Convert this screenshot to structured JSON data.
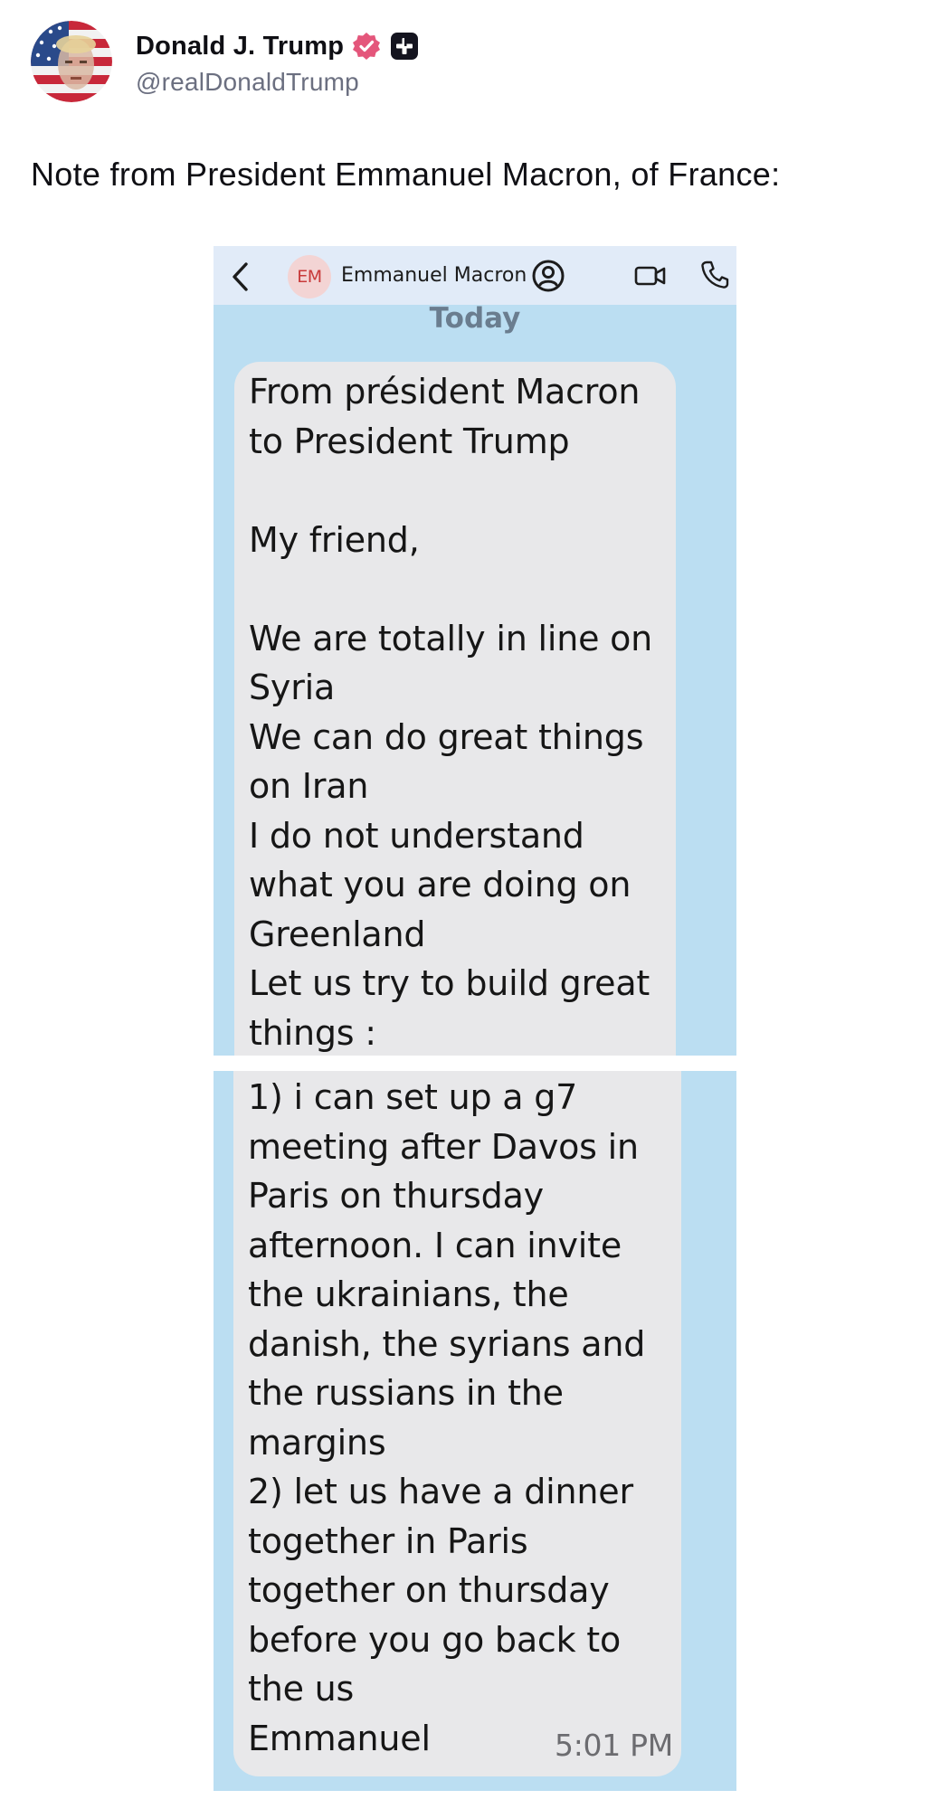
{
  "post": {
    "display_name": "Donald J. Trump",
    "handle": "@realDonaldTrump",
    "avatar_icon": "flag-portrait-avatar",
    "verified_icon": "verified-badge-icon",
    "verified_color": "#e4567b",
    "plus_badge_icon": "plus-badge-icon",
    "text": "Note from President Emmanuel Macron, of France:"
  },
  "attachment": {
    "header": {
      "back_icon": "chevron-left-icon",
      "contact_initials": "EM",
      "contact_name": "Emmanuel Macron",
      "contact_icon": "person-circle-icon",
      "video_icon": "video-camera-icon",
      "phone_icon": "phone-icon",
      "header_bg": "#e1ebf8"
    },
    "date_divider": "Today",
    "chat_bg": "#bbdef2",
    "bubble_bg": "#e8e8ea",
    "message_part1": [
      "From président Macron",
      "to President Trump",
      "",
      "My friend,",
      "",
      "We are totally in line on",
      "Syria",
      "We can do great things",
      "on Iran",
      "I do not understand",
      "what you are doing on",
      "Greenland",
      "Let us try to build great",
      "things :"
    ],
    "message_part2": [
      "1) i can set up a g7",
      "meeting after Davos in",
      "Paris on thursday",
      "afternoon. I can invite",
      "the ukrainians, the",
      "danish, the syrians and",
      "the russians in the",
      "margins",
      "2) let us have a dinner",
      "together in Paris",
      "together on thursday",
      "before you go back to",
      "the us"
    ],
    "signature": "Emmanuel",
    "timestamp": "5:01 PM"
  }
}
